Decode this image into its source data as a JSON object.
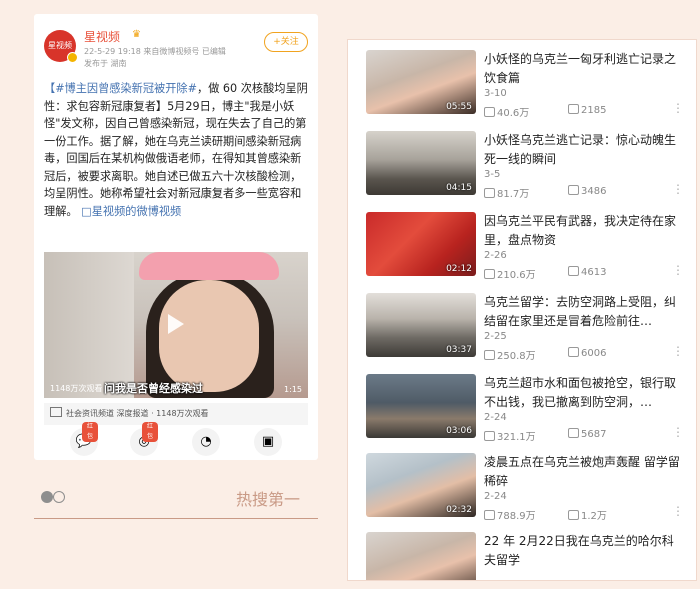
{
  "post": {
    "author": "星视频",
    "meta_line": "22-5-29 19:18  来自微博视频号  已编辑",
    "location": "发布于 湖南",
    "follow_label": "+关注",
    "hashtag": "【#博主因曾感染新冠被开除#",
    "text": "，做 60 次核酸均呈阴性：求包容新冠康复者】5月29日，博主\"我是小妖怪\"发文称，因自己曾感染新冠，现在失去了自己的第一份工作。据了解，她在乌克兰读研期间感染新冠病毒，回国后在某机构做俄语老师，在得知其曾感染新冠后，被要求离职。她自述已做五六十次核酸检测，均呈阴性。她称希望社会对新冠康复者多一些宽容和理解。",
    "link_text": "□星视频的微博视频",
    "video": {
      "views": "1148万次观看",
      "subtitle": "问我是否曾经感染过",
      "duration": "1:15"
    },
    "source_text": "社会资讯频道  深度报道 · 1148万次观看",
    "share_buttons": [
      {
        "name": "wechat-share",
        "glyph": "💬",
        "badge": "红包"
      },
      {
        "name": "moments-share",
        "glyph": "◎",
        "badge": "红包"
      },
      {
        "name": "qq-share",
        "glyph": "◔",
        "badge": ""
      },
      {
        "name": "save-share",
        "glyph": "▣",
        "badge": ""
      }
    ],
    "hot_label": "热搜第一"
  },
  "videos": [
    {
      "title": "小妖怪的乌克兰一匈牙利逃亡记录之饮食篇",
      "date": "3-10",
      "views": "40.6万",
      "comments": "2185",
      "duration": "05:55",
      "thumb": "face"
    },
    {
      "title": "小妖怪乌克兰逃亡记录：惊心动魄生死一线的瞬间",
      "date": "3-5",
      "views": "81.7万",
      "comments": "3486",
      "duration": "04:15",
      "thumb": "street"
    },
    {
      "title": "因乌克兰平民有武器，我决定待在家里，盘点物资",
      "date": "2-26",
      "views": "210.6万",
      "comments": "4613",
      "duration": "02:12",
      "thumb": "red"
    },
    {
      "title": "乌克兰留学：去防空洞路上受阻，纠结留在家里还是冒着危险前往…",
      "date": "2-25",
      "views": "250.8万",
      "comments": "6006",
      "duration": "03:37",
      "thumb": "crowd"
    },
    {
      "title": "乌克兰超市水和面包被抢空，银行取不出钱，我已撤离到防空洞，…",
      "date": "2-24",
      "views": "321.1万",
      "comments": "5687",
      "duration": "03:06",
      "thumb": "shelter"
    },
    {
      "title": "凌晨五点在乌克兰被炮声轰醒 留学留稀碎",
      "date": "2-24",
      "views": "788.9万",
      "comments": "1.2万",
      "duration": "02:32",
      "thumb": "face2"
    },
    {
      "title": "22 年 2月22日我在乌克兰的哈尔科夫留学",
      "date": "",
      "views": "",
      "comments": "",
      "duration": "",
      "thumb": "face"
    }
  ]
}
